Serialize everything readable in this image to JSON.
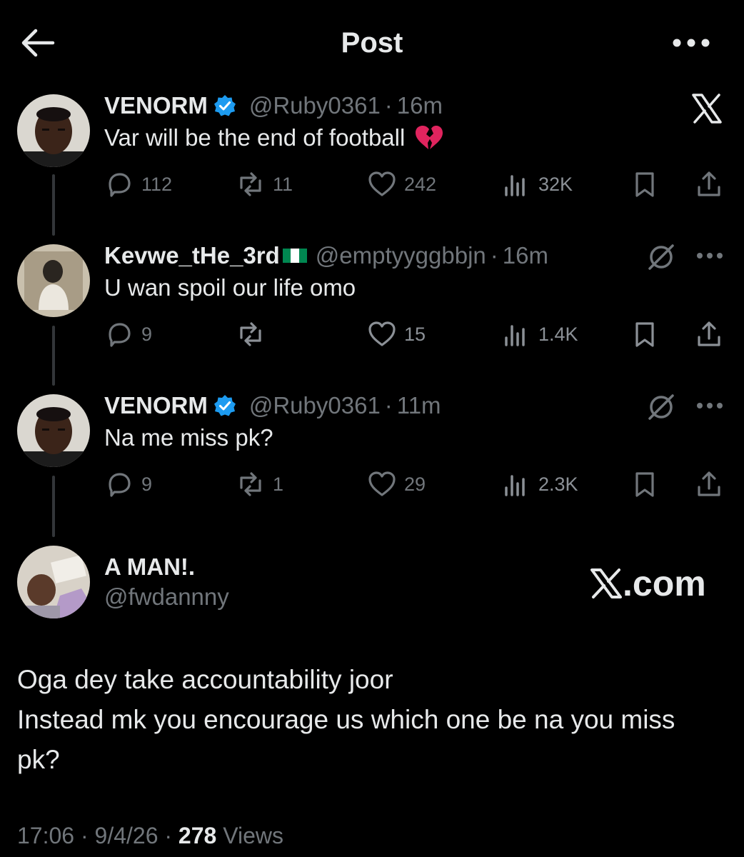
{
  "header": {
    "title": "Post"
  },
  "posts": [
    {
      "name": "VENORM",
      "handle": "@Ruby0361",
      "time": "16m",
      "text": "Var will be the end of football",
      "emoji": "💔",
      "replies": "112",
      "reposts": "11",
      "likes": "242",
      "views": "32K"
    },
    {
      "name": "Kevwe_tHe_3rd",
      "handle": "@emptyyggbbjn",
      "time": "16m",
      "text": "U wan spoil our life omo",
      "replies": "9",
      "reposts": "",
      "likes": "15",
      "views": "1.4K"
    },
    {
      "name": "VENORM",
      "handle": "@Ruby0361",
      "time": "11m",
      "text": "Na me miss pk?",
      "replies": "9",
      "reposts": "1",
      "likes": "29",
      "views": "2.3K"
    }
  ],
  "main_post": {
    "name": "A MAN!.",
    "handle": "@fwdannny",
    "text_lines": [
      "Oga dey take accountability joor",
      "Instead mk you encourage us which one be na you miss",
      "pk?"
    ],
    "time": "17:06",
    "date": "9/4/26",
    "views_count": "278",
    "views_label": "Views"
  },
  "watermark": {
    "domain": ".com"
  },
  "colors": {
    "background": "#000000",
    "text": "#e7e9ea",
    "muted": "#71767b",
    "verified": "#1d9bf0",
    "line": "#333639"
  }
}
